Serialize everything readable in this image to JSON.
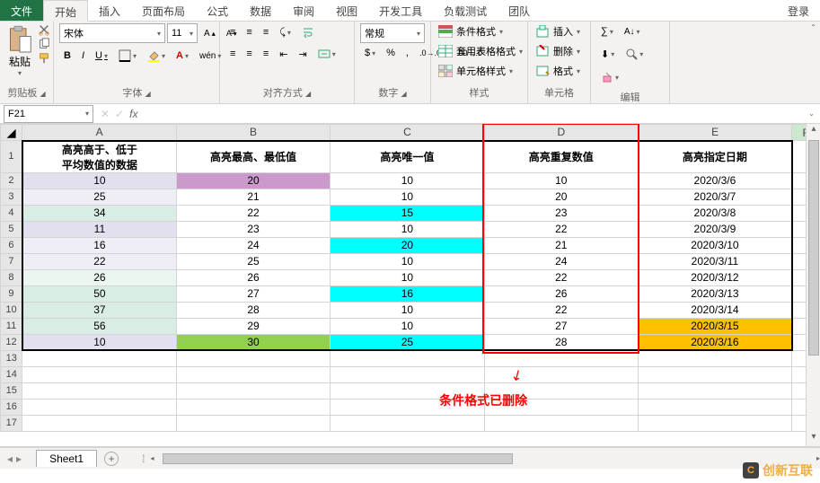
{
  "tabs": {
    "file": "文件",
    "items": [
      "开始",
      "插入",
      "页面布局",
      "公式",
      "数据",
      "审阅",
      "视图",
      "开发工具",
      "负载测试",
      "团队"
    ],
    "active_index": 0,
    "login": "登录"
  },
  "ribbon": {
    "clipboard": {
      "paste": "粘贴",
      "label": "剪贴板"
    },
    "font": {
      "name": "宋体",
      "size": "11",
      "bold": "B",
      "italic": "I",
      "underline": "U",
      "wen": "wén",
      "label": "字体"
    },
    "alignment": {
      "label": "对齐方式"
    },
    "number": {
      "format": "常规",
      "label": "数字"
    },
    "styles": {
      "cond": "条件格式",
      "table": "套用表格格式",
      "cell": "单元格样式",
      "label": "样式"
    },
    "cells": {
      "insert": "插入",
      "delete": "删除",
      "format": "格式",
      "label": "单元格"
    },
    "editing": {
      "label": "编辑"
    }
  },
  "namebox": "F21",
  "fx": "fx",
  "columns": [
    "A",
    "B",
    "C",
    "D",
    "E",
    "F"
  ],
  "headers": {
    "A": "高亮高于、低于\n平均数值的数据",
    "B": "高亮最高、最低值",
    "C": "高亮唯一值",
    "D": "高亮重复数值",
    "E": "高亮指定日期"
  },
  "rows": [
    {
      "r": 2,
      "A": "10",
      "B": "20",
      "C": "10",
      "D": "10",
      "E": "2020/3/6",
      "Af": "fill-lavender",
      "Bf": "fill-plum"
    },
    {
      "r": 3,
      "A": "25",
      "B": "21",
      "C": "10",
      "D": "20",
      "E": "2020/3/7",
      "Af": "fill-lavender-lt"
    },
    {
      "r": 4,
      "A": "34",
      "B": "22",
      "C": "15",
      "D": "23",
      "E": "2020/3/8",
      "Af": "fill-mint",
      "Cf": "fill-cyan"
    },
    {
      "r": 5,
      "A": "11",
      "B": "23",
      "C": "10",
      "D": "22",
      "E": "2020/3/9",
      "Af": "fill-lavender"
    },
    {
      "r": 6,
      "A": "16",
      "B": "24",
      "C": "20",
      "D": "21",
      "E": "2020/3/10",
      "Af": "fill-lavender-lt",
      "Cf": "fill-cyan"
    },
    {
      "r": 7,
      "A": "22",
      "B": "25",
      "C": "10",
      "D": "24",
      "E": "2020/3/11",
      "Af": "fill-lavender-lt"
    },
    {
      "r": 8,
      "A": "26",
      "B": "26",
      "C": "10",
      "D": "22",
      "E": "2020/3/12",
      "Af": "fill-mint-lt"
    },
    {
      "r": 9,
      "A": "50",
      "B": "27",
      "C": "16",
      "D": "26",
      "E": "2020/3/13",
      "Af": "fill-mint",
      "Cf": "fill-cyan"
    },
    {
      "r": 10,
      "A": "37",
      "B": "28",
      "C": "10",
      "D": "22",
      "E": "2020/3/14",
      "Af": "fill-mint"
    },
    {
      "r": 11,
      "A": "56",
      "B": "29",
      "C": "10",
      "D": "27",
      "E": "2020/3/15",
      "Af": "fill-mint",
      "Ef": "fill-orange"
    },
    {
      "r": 12,
      "A": "10",
      "B": "30",
      "C": "25",
      "D": "28",
      "E": "2020/3/16",
      "Af": "fill-lavender",
      "Bf": "fill-green",
      "Cf": "fill-cyan",
      "Ef": "fill-orange"
    }
  ],
  "empty_rows": [
    13,
    14,
    15,
    16,
    17
  ],
  "annotation": "条件格式已删除",
  "sheet": {
    "name": "Sheet1"
  },
  "watermark": "创新互联"
}
